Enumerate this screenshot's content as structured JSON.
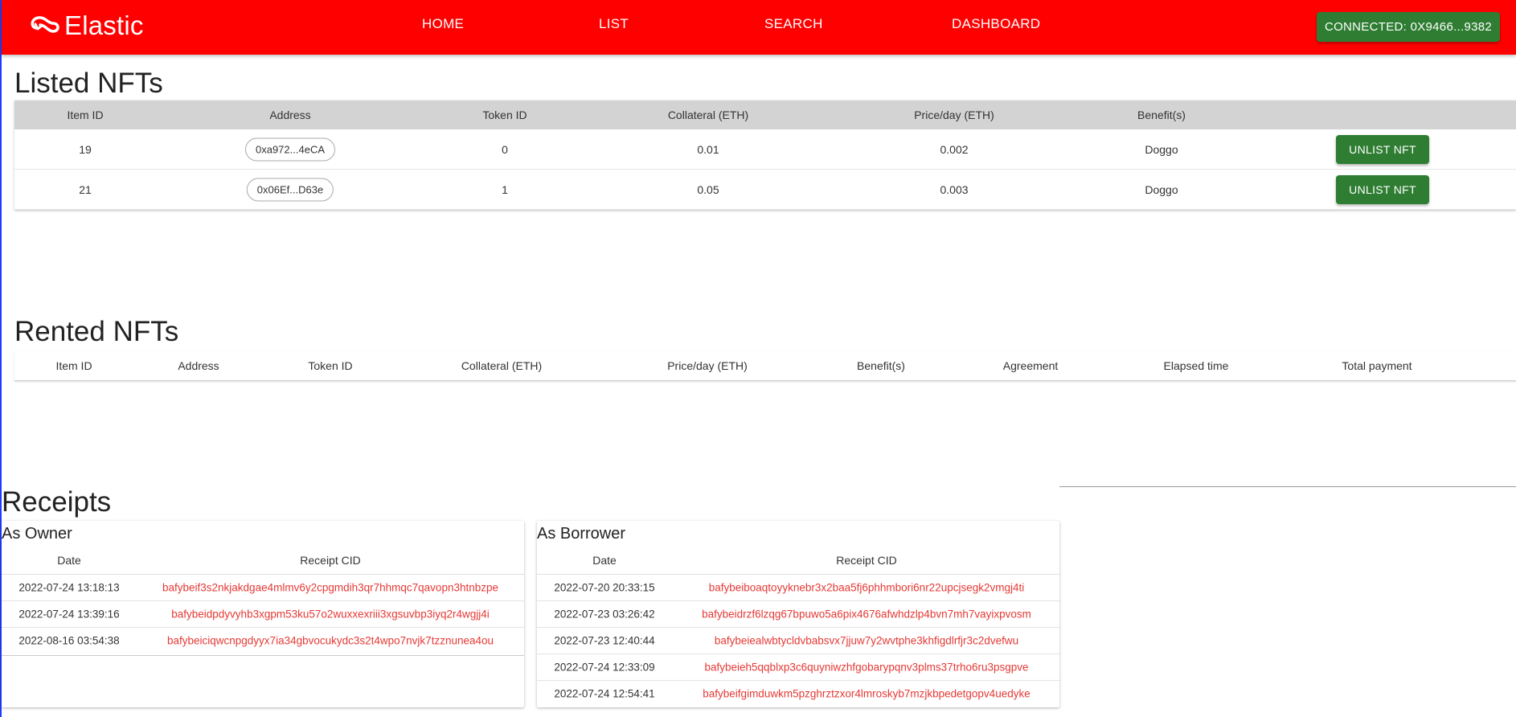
{
  "header": {
    "logo_text": "Elastic",
    "nav": [
      "HOME",
      "LIST",
      "SEARCH",
      "DASHBOARD"
    ],
    "connect_label": "CONNECTED: 0X9466...9382",
    "bg_color": "#ff0000",
    "button_color": "#2e7d32"
  },
  "listed": {
    "title": "Listed NFTs",
    "columns": [
      "Item ID",
      "Address",
      "Token ID",
      "Collateral (ETH)",
      "Price/day (ETH)",
      "Benefit(s)"
    ],
    "rows": [
      {
        "item_id": "19",
        "address": "0xa972...4eCA",
        "token_id": "0",
        "collateral": "0.01",
        "price": "0.002",
        "benefit": "Doggo",
        "action": "UNLIST NFT"
      },
      {
        "item_id": "21",
        "address": "0x06Ef...D63e",
        "token_id": "1",
        "collateral": "0.05",
        "price": "0.003",
        "benefit": "Doggo",
        "action": "UNLIST NFT"
      }
    ]
  },
  "rented": {
    "title": "Rented NFTs",
    "columns": [
      "Item ID",
      "Address",
      "Token ID",
      "Collateral (ETH)",
      "Price/day (ETH)",
      "Benefit(s)",
      "Agreement",
      "Elapsed time",
      "Total payment"
    ]
  },
  "receipts": {
    "title": "Receipts",
    "owner": {
      "title": "As Owner",
      "columns": [
        "Date",
        "Receipt CID"
      ],
      "rows": [
        {
          "date": "2022-07-24 13:18:13",
          "cid": "bafybeif3s2nkjakdgae4mlmv6y2cpgmdih3qr7hhmqc7qavopn3htnbzpe"
        },
        {
          "date": "2022-07-24 13:39:16",
          "cid": "bafybeidpdyvyhb3xgpm53ku57o2wuxxexriii3xgsuvbp3iyq2r4wgjj4i"
        },
        {
          "date": "2022-08-16 03:54:38",
          "cid": "bafybeiciqwcnpgdyyx7ia34gbvocukydc3s2t4wpo7nvjk7tzznunea4ou"
        }
      ]
    },
    "borrower": {
      "title": "As Borrower",
      "columns": [
        "Date",
        "Receipt CID"
      ],
      "rows": [
        {
          "date": "2022-07-20 20:33:15",
          "cid": "bafybeiboaqtoyyknebr3x2baa5fj6phhmbori6nr22upcjsegk2vmgj4ti"
        },
        {
          "date": "2022-07-23 03:26:42",
          "cid": "bafybeidrzf6lzqg67bpuwo5a6pix4676afwhdzlp4bvn7mh7vayixpvosm"
        },
        {
          "date": "2022-07-23 12:40:44",
          "cid": "bafybeiealwbtycldvbabsvx7jjuw7y2wvtphe3khfigdlrfjr3c2dvefwu"
        },
        {
          "date": "2022-07-24 12:33:09",
          "cid": "bafybeieh5qqblxp3c6quyniwzhfgobarypqnv3plms37trho6ru3psgpve"
        },
        {
          "date": "2022-07-24 12:54:41",
          "cid": "bafybeifgimduwkm5pzghrztzxor4lmroskyb7mzjkbpedetgopv4uedyke"
        }
      ]
    },
    "cid_color": "#e53935"
  }
}
